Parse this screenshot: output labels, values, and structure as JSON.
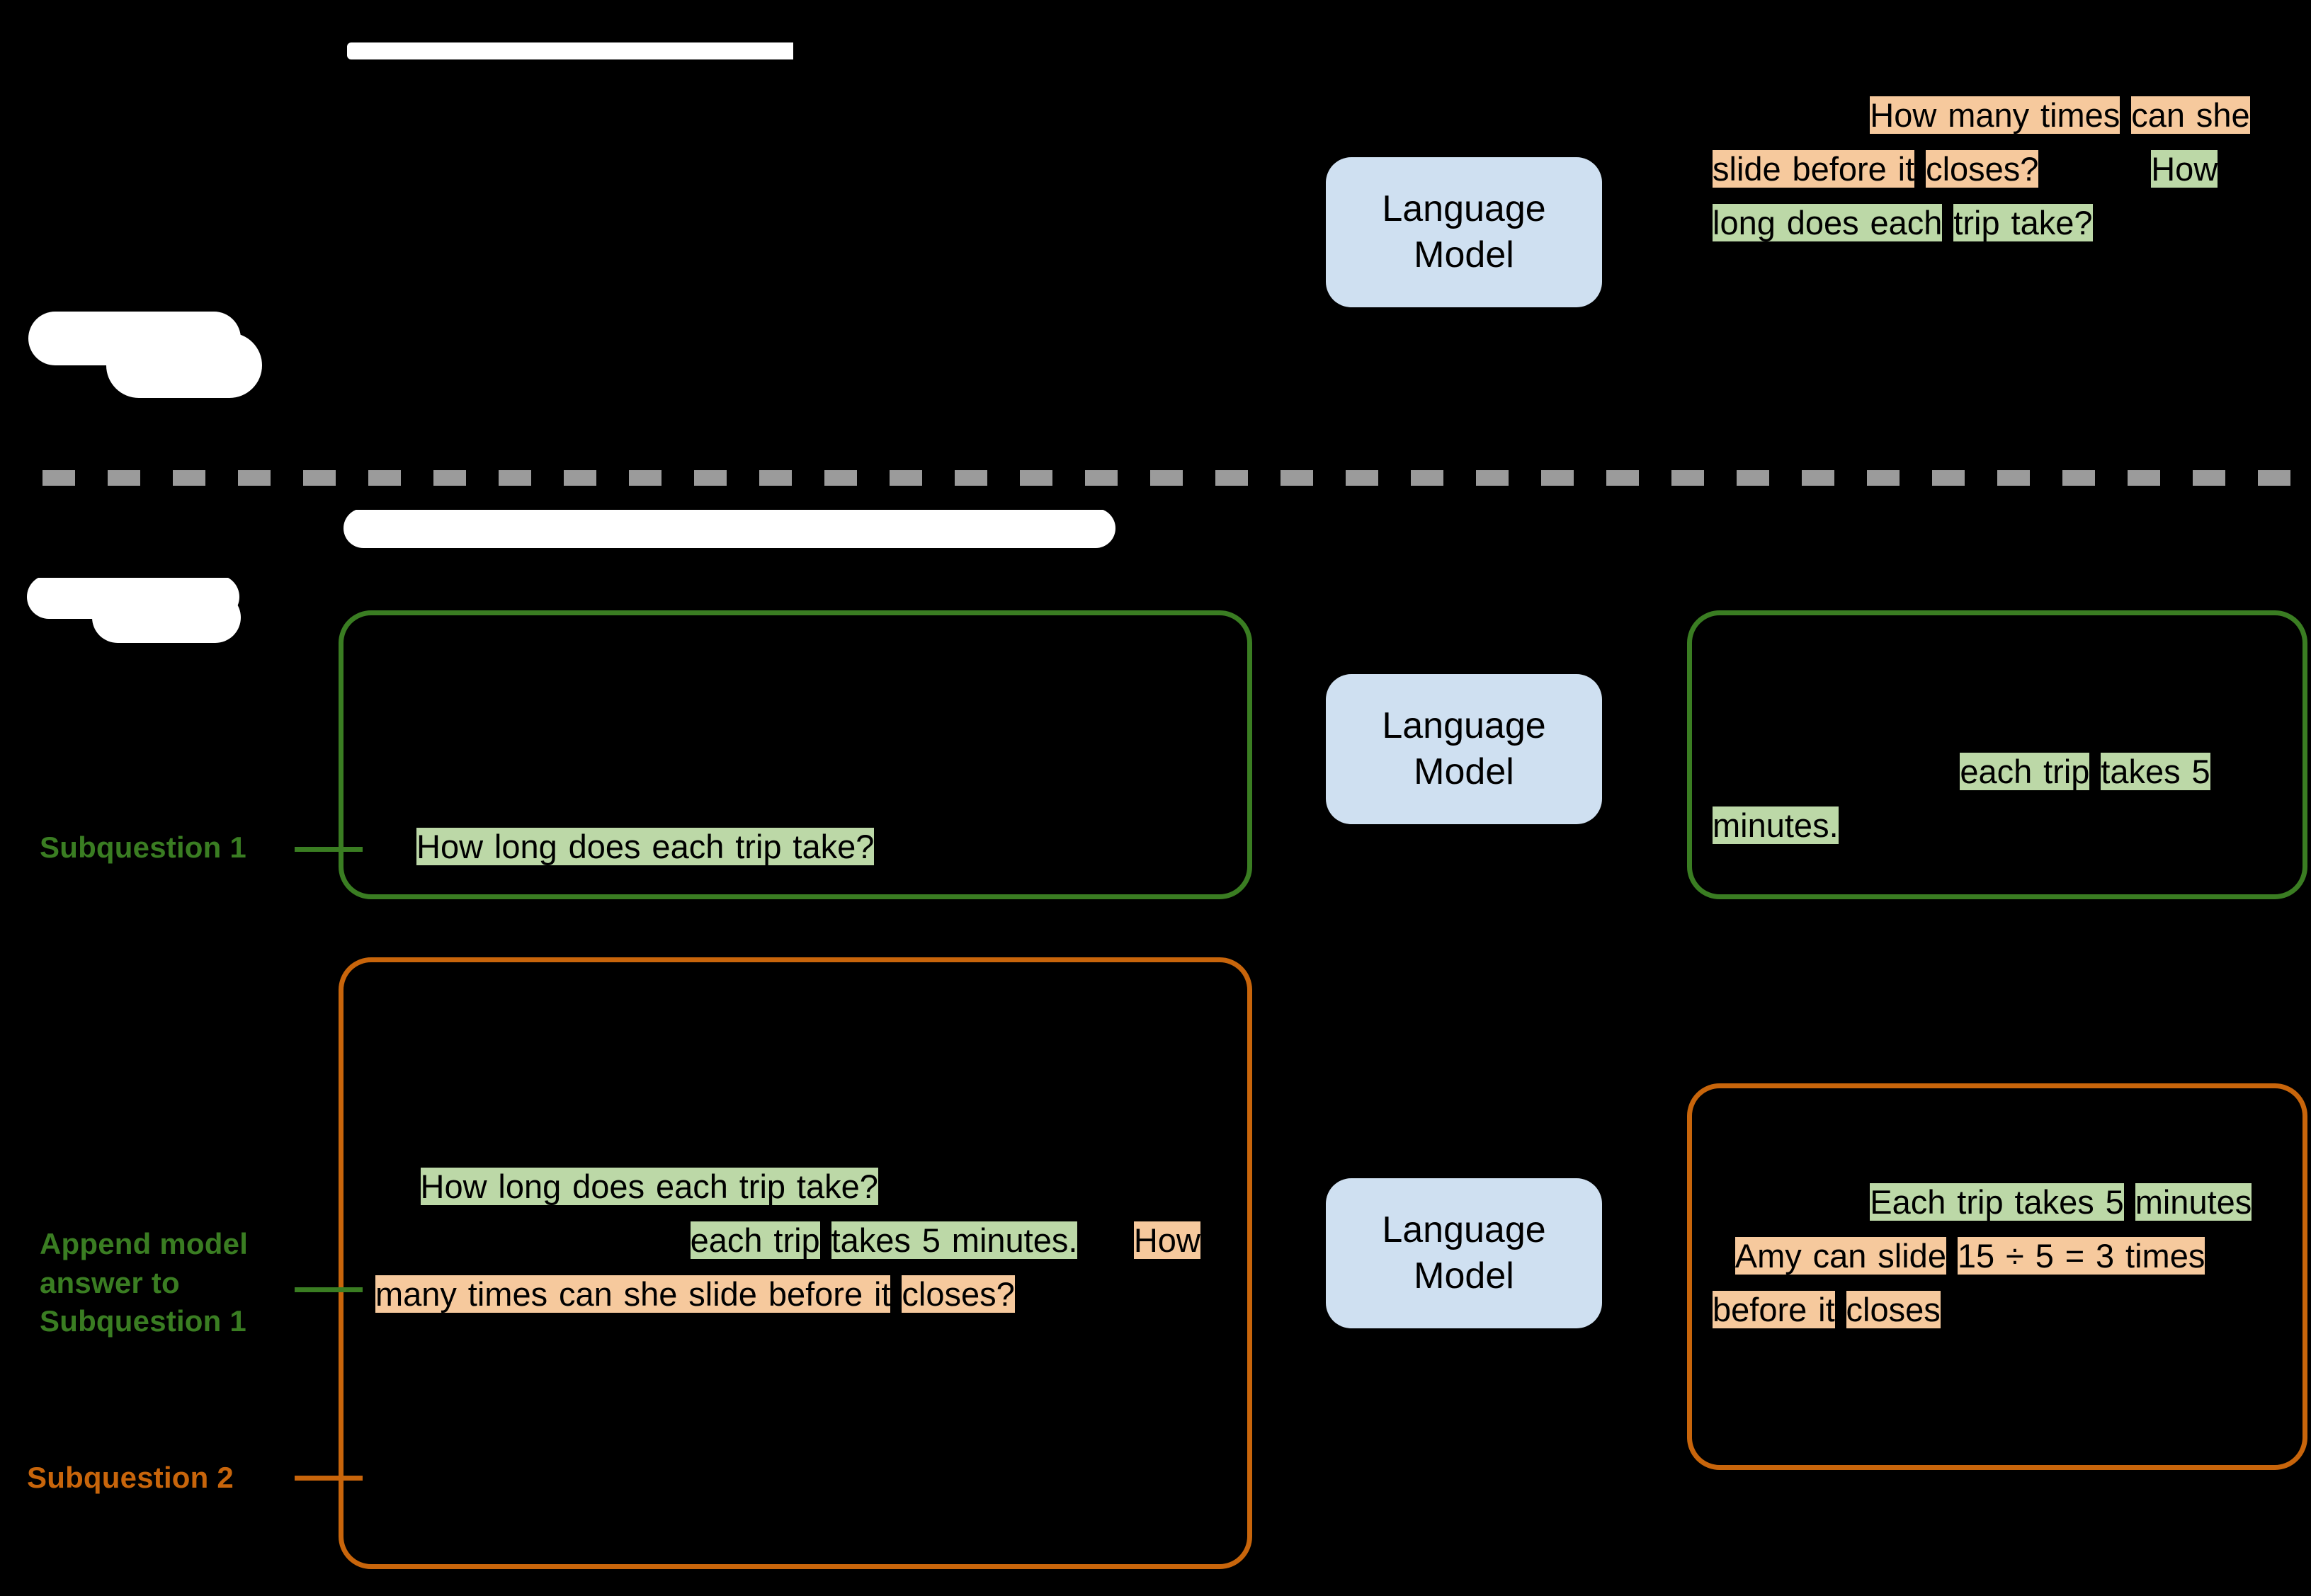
{
  "figure": {
    "background_color": "#000000",
    "divider_color": "#9b9b9b",
    "accent_green": "#3a7d22",
    "accent_orange": "#c8650b",
    "highlight_green": "#bcd8a7",
    "highlight_orange": "#f6c99d",
    "lm_box_color": "#cfe0f1"
  },
  "stage1": {
    "title": "",
    "lm_label_line1": "Language",
    "lm_label_line2": "Model",
    "output": {
      "seg1": "How many times",
      "seg2": "can she slide before it",
      "seg3": "closes?",
      "seg4": "How long does each",
      "seg5": "trip take?"
    }
  },
  "stage2": {
    "title": "",
    "lm_label_line1": "Language",
    "lm_label_line2": "Model",
    "labels": {
      "subquestion_1": "Subquestion 1",
      "append_line1": "Append model",
      "append_line2": "answer to",
      "append_line3": "Subquestion 1",
      "subquestion_2": "Subquestion 2"
    },
    "panel_a_input": {
      "seg1": "How long does each trip take?"
    },
    "panel_a_output": {
      "seg1": "each trip",
      "seg2": "takes 5 minutes."
    },
    "panel_b_input": {
      "seg1": "How long does each trip take?",
      "seg2": "each trip",
      "seg3": "takes 5 minutes.",
      "seg4": "How many times can she slide before it",
      "seg5": "closes?"
    },
    "panel_b_output": {
      "seg1": "Each trip takes 5",
      "seg2": "minutes",
      "seg3": "Amy can slide",
      "seg4": "15 ÷ 5 = 3 times before it",
      "seg5": "closes"
    }
  }
}
